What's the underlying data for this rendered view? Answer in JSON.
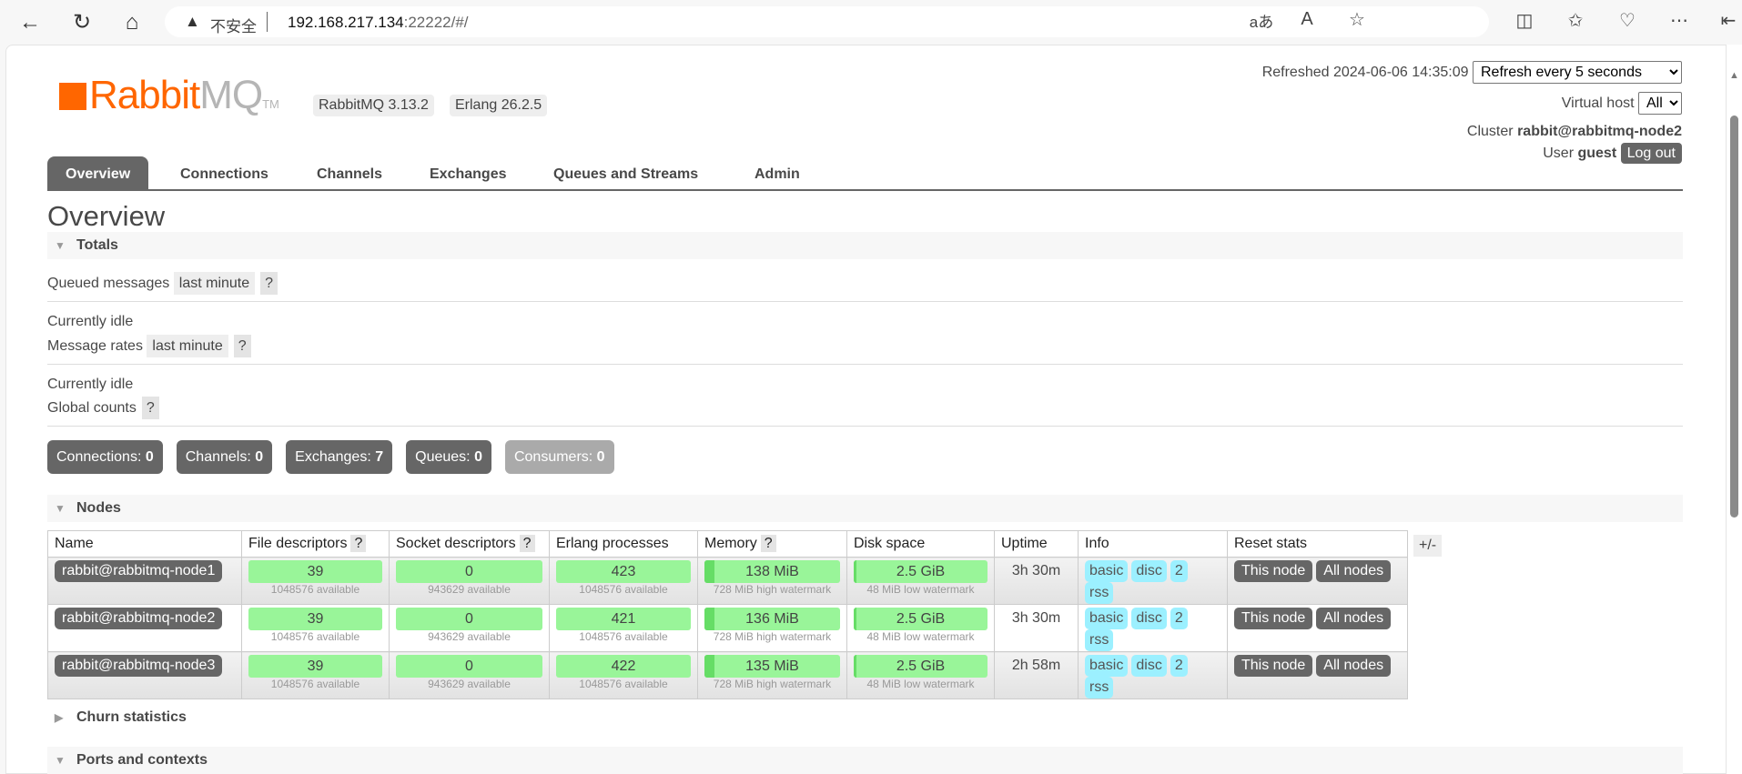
{
  "browser": {
    "insecure_label": "不安全",
    "url_host": "192.168.217.134",
    "url_rest": ":22222/#/"
  },
  "header": {
    "logo_text_a": "Rabbit",
    "logo_text_b": "MQ",
    "logo_tm": "TM",
    "rabbitmq_version": "RabbitMQ 3.13.2",
    "erlang_version": "Erlang 26.2.5",
    "refreshed": "Refreshed 2024-06-06 14:35:09",
    "refresh_select": "Refresh every 5 seconds",
    "vhost_label": "Virtual host",
    "vhost_select": "All",
    "cluster_label": "Cluster",
    "cluster_name": "rabbit@rabbitmq-node2",
    "user_label": "User",
    "user_name": "guest",
    "logout": "Log out"
  },
  "nav": {
    "tabs": [
      "Overview",
      "Connections",
      "Channels",
      "Exchanges",
      "Queues and Streams",
      "Admin"
    ],
    "active": "Overview"
  },
  "page_title": "Overview",
  "totals": {
    "title": "Totals",
    "queued_label": "Queued messages",
    "queued_range": "last minute",
    "help": "?",
    "idle1": "Currently idle",
    "rates_label": "Message rates",
    "rates_range": "last minute",
    "idle2": "Currently idle",
    "global_label": "Global counts",
    "counts": [
      {
        "label": "Connections:",
        "value": "0"
      },
      {
        "label": "Channels:",
        "value": "0"
      },
      {
        "label": "Exchanges:",
        "value": "7"
      },
      {
        "label": "Queues:",
        "value": "0"
      },
      {
        "label": "Consumers:",
        "value": "0"
      }
    ]
  },
  "nodes": {
    "title": "Nodes",
    "plus_minus": "+/-",
    "columns": [
      "Name",
      "File descriptors",
      "Socket descriptors",
      "Erlang processes",
      "Memory",
      "Disk space",
      "Uptime",
      "Info",
      "Reset stats"
    ],
    "info_tags": [
      "basic",
      "disc",
      "2",
      "rss"
    ],
    "reset_buttons": [
      "This node",
      "All nodes"
    ],
    "rows": [
      {
        "name": "rabbit@rabbitmq-node1",
        "fd": "39",
        "fd_avail": "1048576 available",
        "sd": "0",
        "sd_avail": "943629 available",
        "ep": "423",
        "ep_avail": "1048576 available",
        "mem": "138 MiB",
        "mem_fraction": 0.19,
        "mem_sub": "728 MiB high watermark",
        "disk": "2.5 GiB",
        "disk_sub": "48 MiB low watermark",
        "uptime": "3h 30m"
      },
      {
        "name": "rabbit@rabbitmq-node2",
        "fd": "39",
        "fd_avail": "1048576 available",
        "sd": "0",
        "sd_avail": "943629 available",
        "ep": "421",
        "ep_avail": "1048576 available",
        "mem": "136 MiB",
        "mem_fraction": 0.19,
        "mem_sub": "728 MiB high watermark",
        "disk": "2.5 GiB",
        "disk_sub": "48 MiB low watermark",
        "uptime": "3h 30m"
      },
      {
        "name": "rabbit@rabbitmq-node3",
        "fd": "39",
        "fd_avail": "1048576 available",
        "sd": "0",
        "sd_avail": "943629 available",
        "ep": "422",
        "ep_avail": "1048576 available",
        "mem": "135 MiB",
        "mem_fraction": 0.19,
        "mem_sub": "728 MiB high watermark",
        "disk": "2.5 GiB",
        "disk_sub": "48 MiB low watermark",
        "uptime": "2h 58m"
      }
    ]
  },
  "churn": {
    "title": "Churn statistics"
  },
  "ports": {
    "title": "Ports and contexts"
  },
  "colors": {
    "brand": "#ff6600",
    "bar_green": "#99f599",
    "info_blue": "#9cf0ff",
    "dark_button": "#666666"
  }
}
